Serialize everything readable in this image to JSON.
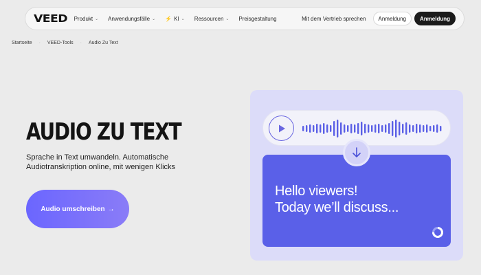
{
  "nav": {
    "logo": "VEED",
    "items": [
      {
        "label": "Produkt",
        "has_chevron": true
      },
      {
        "label": "Anwendungsfälle",
        "has_chevron": true
      },
      {
        "label": "KI",
        "has_chevron": true,
        "icon": "sparkle-icon"
      },
      {
        "label": "Ressourcen",
        "has_chevron": true
      },
      {
        "label": "Preisgestaltung",
        "has_chevron": false
      }
    ],
    "sales_link": "Mit dem Vertrieb sprechen",
    "login_light": "Anmeldung",
    "login_dark": "Anmeldung"
  },
  "breadcrumb": [
    "Startseite",
    "VEED-Tools",
    "Audio Zu Text"
  ],
  "hero": {
    "title": "AUDIO ZU TEXT",
    "subtitle": "Sprache in Text umwandeln. Automatische Audiotranskription online, mit wenigen Klicks",
    "cta_label": "Audio umschreiben",
    "cta_arrow": "→"
  },
  "illustration": {
    "transcript_line1": "Hello viewers!",
    "transcript_line2": "Today we’ll discuss...",
    "colors": {
      "panel": "#dcdcf9",
      "card": "#5a60e8",
      "accent": "#6a67e0"
    }
  }
}
